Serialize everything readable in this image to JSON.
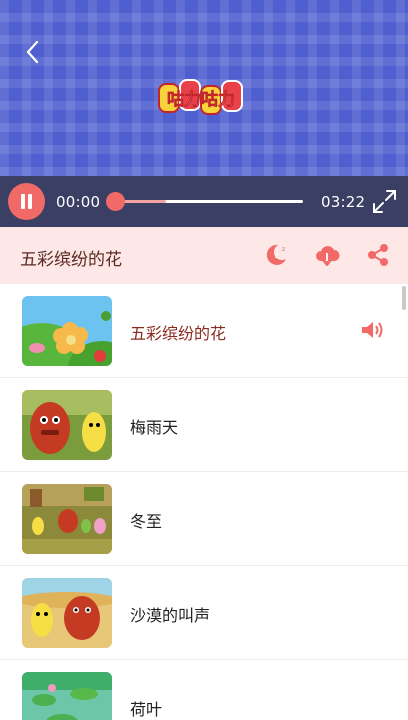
{
  "video": {
    "logo_text": "咕力咕力"
  },
  "player": {
    "current_time": "00:00",
    "duration": "03:22",
    "progress_fraction": 0.0,
    "buffered_fraction": 0.28
  },
  "now_playing": {
    "title": "五彩缤纷的花"
  },
  "playlist": [
    {
      "title": "五彩缤纷的花",
      "active": true
    },
    {
      "title": "梅雨天",
      "active": false
    },
    {
      "title": "冬至",
      "active": false
    },
    {
      "title": "沙漠的叫声",
      "active": false
    },
    {
      "title": "荷叶",
      "active": false
    }
  ],
  "colors": {
    "accent": "#f26a68",
    "video_bg": "#4f5fd0",
    "player_bar": "#3a3f63",
    "header_bg": "#fde7e7",
    "active_title": "#8b2a1e"
  },
  "icons": {
    "back": "chevron-left-icon",
    "pause": "pause-icon",
    "fullscreen": "fullscreen-icon",
    "sleep": "moon-timer-icon",
    "download": "download-cloud-icon",
    "share": "share-icon",
    "speaker": "speaker-icon"
  }
}
